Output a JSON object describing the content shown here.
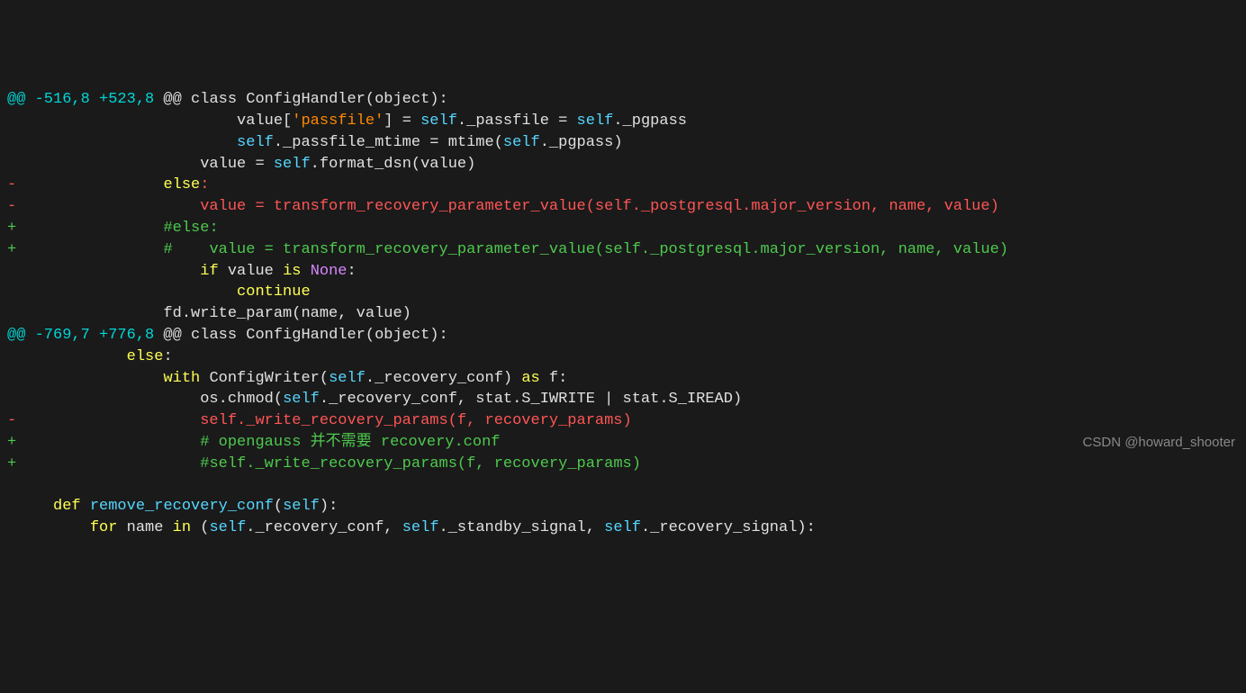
{
  "diff": {
    "hunk1": {
      "header_prefix": "@@ ",
      "header_range": "-516,8 +523,8",
      "header_suffix": " @@ class ConfigHandler(object):",
      "lines": [
        {
          "type": "ctx",
          "indent": "                        ",
          "tokens": [
            "value",
            "[",
            "'passfile'",
            "]",
            " = ",
            "self",
            ".",
            "_passfile",
            " = ",
            "self",
            ".",
            "_pgpass"
          ]
        },
        {
          "type": "ctx",
          "indent": "                        ",
          "tokens": [
            "self",
            ".",
            "_passfile_mtime",
            " = ",
            "mtime",
            "(",
            "self",
            ".",
            "_pgpass",
            ")"
          ]
        },
        {
          "type": "ctx",
          "indent": "                    ",
          "tokens": [
            "value",
            " = ",
            "self",
            ".",
            "format_dsn",
            "(",
            "value",
            ")"
          ]
        },
        {
          "type": "removed",
          "indent": "                ",
          "text": "else:"
        },
        {
          "type": "removed",
          "indent": "                    ",
          "text": "value = transform_recovery_parameter_value(self._postgresql.major_version, name, value)"
        },
        {
          "type": "added",
          "indent": "                ",
          "text": "#else:"
        },
        {
          "type": "added",
          "indent": "                ",
          "text": "#    value = transform_recovery_parameter_value(self._postgresql.major_version, name, value)"
        },
        {
          "type": "ctx",
          "indent": "                ",
          "tokens": [
            "if",
            " ",
            "value",
            " ",
            "is",
            " ",
            "None",
            ":"
          ]
        },
        {
          "type": "ctx",
          "indent": "                    ",
          "tokens": [
            "continue"
          ]
        },
        {
          "type": "ctx",
          "indent": "                ",
          "tokens": [
            "fd",
            ".",
            "write_param",
            "(",
            "name",
            ", ",
            "value",
            ")"
          ]
        }
      ]
    },
    "hunk2": {
      "header_prefix": "@@ ",
      "header_range": "-769,7 +776,8",
      "header_suffix": " @@ class ConfigHandler(object):",
      "lines": [
        {
          "type": "ctx",
          "indent": "            ",
          "tokens": [
            "else",
            ":"
          ]
        },
        {
          "type": "ctx",
          "indent": "                ",
          "tokens": [
            "with",
            " ",
            "ConfigWriter",
            "(",
            "self",
            ".",
            "_recovery_conf",
            ")",
            " ",
            "as",
            " ",
            "f",
            ":"
          ]
        },
        {
          "type": "ctx",
          "indent": "                    ",
          "tokens": [
            "os",
            ".",
            "chmod",
            "(",
            "self",
            ".",
            "_recovery_conf",
            ", ",
            "stat",
            ".",
            "S_IWRITE",
            " | ",
            "stat",
            ".",
            "S_IREAD",
            ")"
          ]
        },
        {
          "type": "removed",
          "indent": "                    ",
          "text": "self._write_recovery_params(f, recovery_params)"
        },
        {
          "type": "added",
          "indent": "                    ",
          "text": "# opengauss 并不需要 recovery.conf"
        },
        {
          "type": "added",
          "indent": "                    ",
          "text": "#self._write_recovery_params(f, recovery_params)"
        },
        {
          "type": "blank",
          "text": ""
        },
        {
          "type": "ctx",
          "indent": "    ",
          "tokens": [
            "def",
            " ",
            "remove_recovery_conf",
            "(",
            "self",
            ")",
            ":"
          ]
        },
        {
          "type": "ctx",
          "indent": "        ",
          "tokens": [
            "for",
            " ",
            "name",
            " ",
            "in",
            " ",
            "(",
            "self",
            ".",
            "_recovery_conf",
            ", ",
            "self",
            ".",
            "_standby_signal",
            ", ",
            "self",
            ".",
            "_recovery_signal",
            ")",
            ":"
          ]
        }
      ]
    }
  },
  "watermark": "CSDN @howard_shooter"
}
